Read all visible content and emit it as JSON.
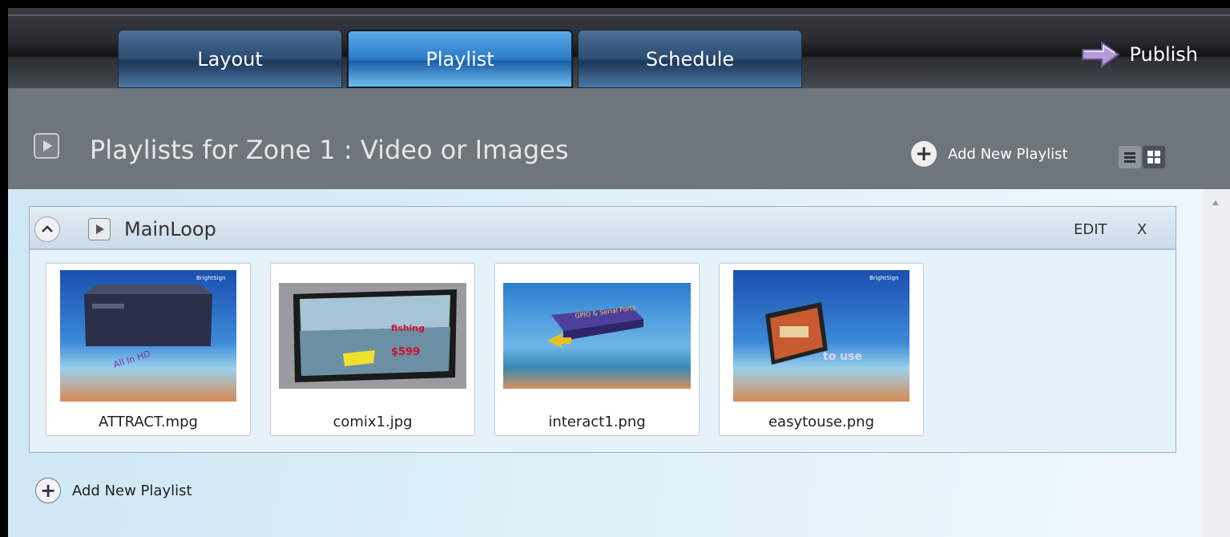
{
  "tabs": [
    {
      "label": "Layout",
      "active": false
    },
    {
      "label": "Playlist",
      "active": true
    },
    {
      "label": "Schedule",
      "active": false
    }
  ],
  "publish": {
    "label": "Publish",
    "icon": "arrow-right-icon"
  },
  "header": {
    "title": "Playlists for Zone 1 : Video or Images",
    "add_label": "Add New Playlist",
    "view_modes": [
      "list-view",
      "grid-view"
    ]
  },
  "playlist": {
    "name": "MainLoop",
    "edit_label": "EDIT",
    "remove_label": "X",
    "items": [
      {
        "file": "ATTRACT.mpg"
      },
      {
        "file": "comix1.jpg"
      },
      {
        "file": "interact1.png"
      },
      {
        "file": "easytouse.png"
      }
    ]
  },
  "footer": {
    "add_label": "Add New Playlist"
  },
  "colors": {
    "accent_tab": "#2d7cc8",
    "content_bg": "#d9eef8",
    "header_bg": "#6e767c"
  }
}
